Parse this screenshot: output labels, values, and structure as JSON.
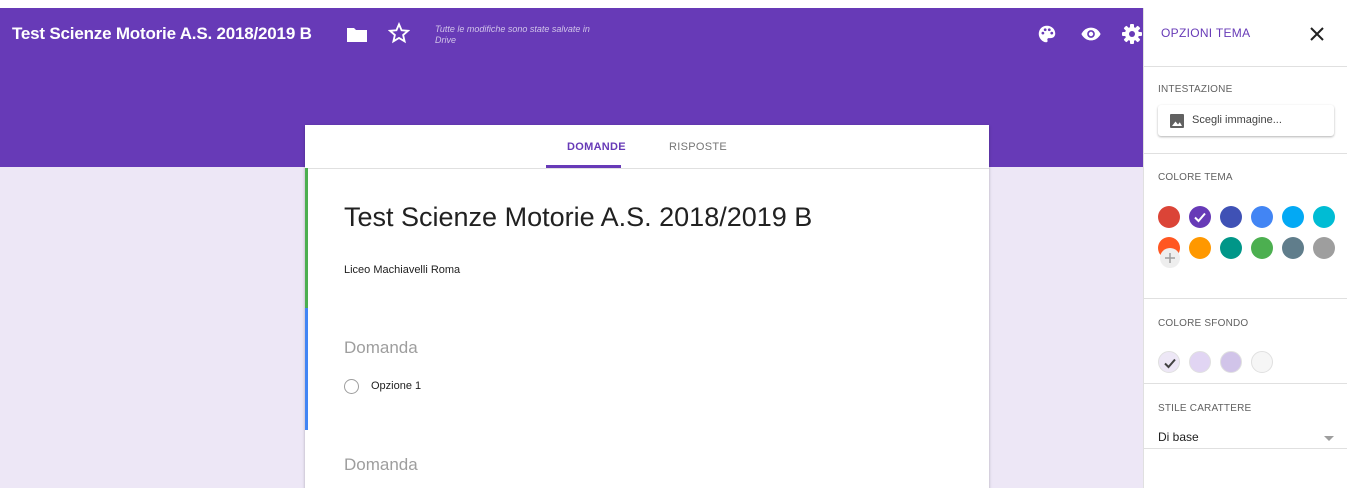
{
  "header": {
    "title": "Test Scienze Motorie A.S. 2018/2019 B",
    "saved_status": "Tutte le modifiche sono state salvate in Drive",
    "icons": [
      "folder-icon",
      "star-icon",
      "palette-icon",
      "eye-icon",
      "gear-icon"
    ]
  },
  "tabs": {
    "questions": "DOMANDE",
    "responses": "RISPOSTE"
  },
  "form": {
    "title": "Test Scienze Motorie A.S. 2018/2019 B",
    "description": "Liceo Machiavelli Roma",
    "questions": [
      {
        "title": "Domanda",
        "option": "Opzione 1"
      },
      {
        "title": "Domanda"
      }
    ]
  },
  "theme_panel": {
    "title": "OPZIONI TEMA",
    "header_label": "INTESTAZIONE",
    "choose_image": "Scegli immagine...",
    "theme_color_label": "COLORE TEMA",
    "theme_colors": [
      "#db4437",
      "#673ab7",
      "#3f51b5",
      "#4285f4",
      "#03a9f4",
      "#00bcd4",
      "#ff5722",
      "#ff9800",
      "#009688",
      "#4caf50",
      "#607d8b",
      "#9e9e9e"
    ],
    "theme_selected": "#673ab7",
    "bg_color_label": "COLORE SFONDO",
    "bg_colors": [
      "#ede7f6",
      "#e1d5f3",
      "#d1c4e9",
      "#f6f6f6"
    ],
    "bg_selected": "#ede7f6",
    "font_style_label": "STILE CARATTERE",
    "font_style_value": "Di base"
  }
}
